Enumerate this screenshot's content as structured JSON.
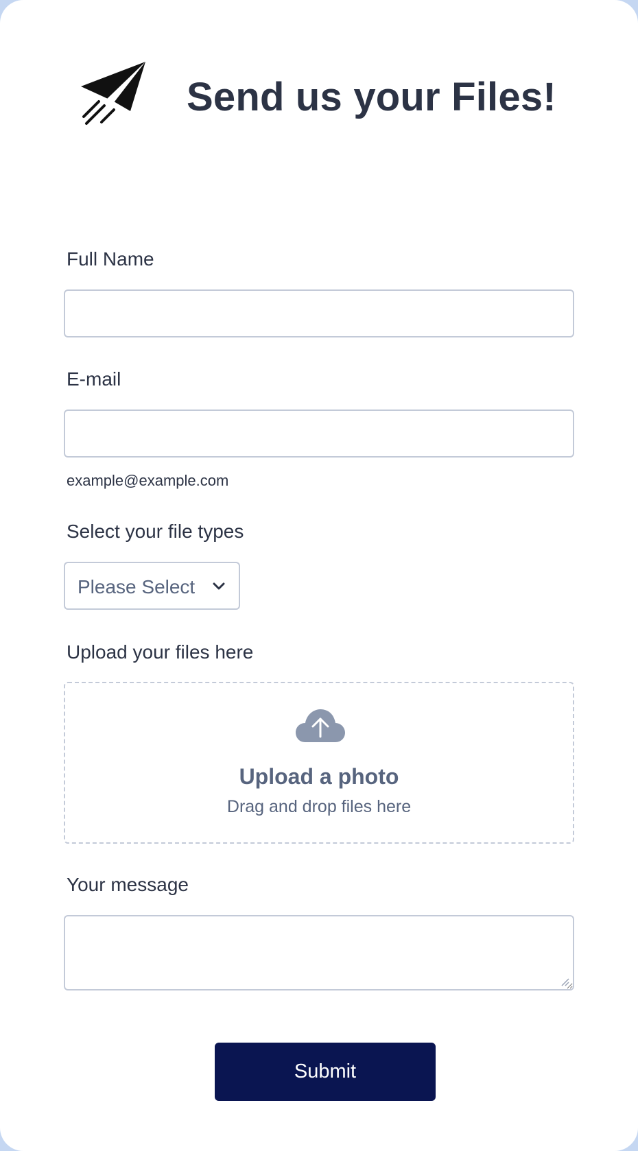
{
  "header": {
    "title": "Send us your Files!",
    "logo_icon": "paper-plane-icon"
  },
  "form": {
    "full_name": {
      "label": "Full Name",
      "value": "",
      "placeholder": ""
    },
    "email": {
      "label": "E-mail",
      "value": "",
      "placeholder": "",
      "sublabel": "example@example.com"
    },
    "file_types": {
      "label": "Select your file types",
      "selected": "Please Select",
      "icon": "chevron-down-icon"
    },
    "upload": {
      "label": "Upload your files here",
      "icon": "cloud-upload-icon",
      "title": "Upload a photo",
      "subtitle": "Drag and drop files here"
    },
    "message": {
      "label": "Your message",
      "value": ""
    },
    "submit_label": "Submit"
  },
  "colors": {
    "page_background": "#c5d7f2",
    "card": "#ffffff",
    "text": "#2c3345",
    "muted_text": "#57647e",
    "border": "#c3cad8",
    "upload_icon": "#8b97ad",
    "submit_button": "#0a1551",
    "submit_text": "#ffffff"
  }
}
